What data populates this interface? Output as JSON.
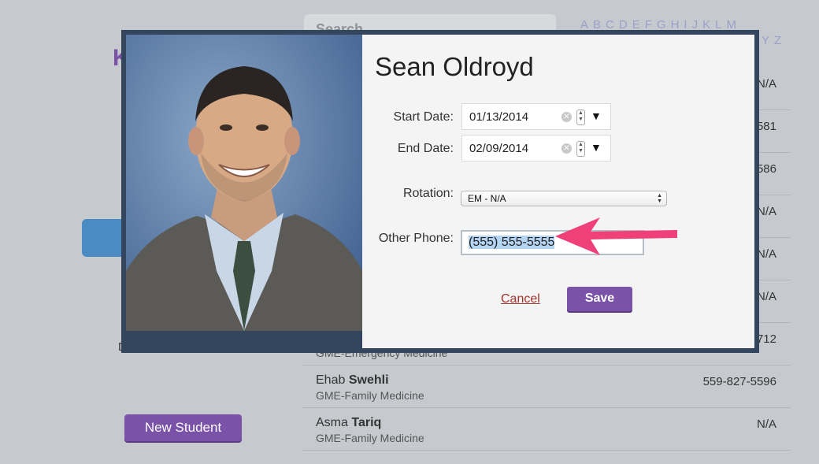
{
  "background": {
    "search_placeholder": "Search",
    "alphabet_row1": [
      "A",
      "B",
      "C",
      "D",
      "E",
      "F",
      "G",
      "H",
      "I",
      "J",
      "K",
      "L",
      "M"
    ],
    "alphabet_row2": [
      "Y",
      "Z"
    ],
    "heading_fragment": "K",
    "left_label_fragment": "D",
    "new_student_label": "New Student",
    "list_rows": [
      {
        "name_first": "",
        "name_last": "",
        "dept": "",
        "phone": "N/A"
      },
      {
        "name_first": "",
        "name_last": "",
        "dept": "",
        "phone": "581"
      },
      {
        "name_first": "",
        "name_last": "",
        "dept": "",
        "phone": "586"
      },
      {
        "name_first": "",
        "name_last": "",
        "dept": "",
        "phone": "N/A"
      },
      {
        "name_first": "",
        "name_last": "",
        "dept": "",
        "phone": "N/A"
      },
      {
        "name_first": "",
        "name_last": "",
        "dept": "",
        "phone": "N/A"
      },
      {
        "name_first": "",
        "name_last": "",
        "dept": "GME-Emergency Medicine",
        "phone": "712"
      },
      {
        "name_first": "Ehab",
        "name_last": "Swehli",
        "dept": "GME-Family Medicine",
        "phone": "559-827-5596"
      },
      {
        "name_first": "Asma",
        "name_last": "Tariq",
        "dept": "GME-Family Medicine",
        "phone": "N/A"
      }
    ]
  },
  "modal": {
    "person_name": "Sean Oldroyd",
    "start_date_label": "Start Date:",
    "start_date_value": "01/13/2014",
    "end_date_label": "End Date:",
    "end_date_value": "02/09/2014",
    "rotation_label": "Rotation:",
    "rotation_value": "EM - N/A",
    "other_phone_label": "Other Phone:",
    "other_phone_value": "(555) 555-5555",
    "cancel_label": "Cancel",
    "save_label": "Save"
  },
  "colors": {
    "accent_purple": "#7a52a8",
    "annotation_arrow": "#f0407a",
    "modal_frame": "#34465e"
  }
}
